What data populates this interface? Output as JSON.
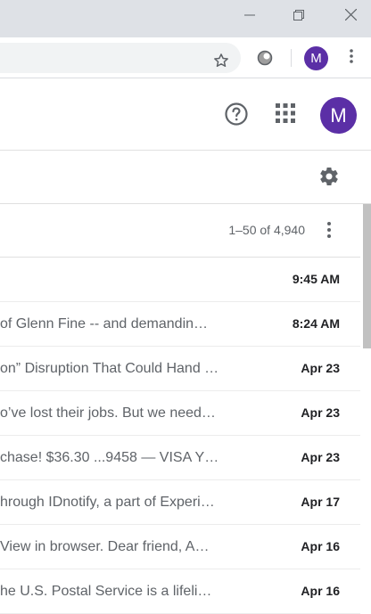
{
  "browser": {
    "window_controls": {
      "minimize_icon": "minimize-icon",
      "restore_icon": "restore-icon",
      "close_icon": "close-icon"
    },
    "profile_initial": "M"
  },
  "gmail_header": {
    "avatar_initial": "M",
    "accent_color": "#5b2fa6"
  },
  "toolbar": {
    "pagination": "1–50 of 4,940"
  },
  "emails": [
    {
      "snippet": "",
      "time": "9:45 AM"
    },
    {
      "snippet": "of Glenn Fine -- and demandin…",
      "time": "8:24 AM"
    },
    {
      "snippet": "on” Disruption That Could Hand …",
      "time": "Apr 23"
    },
    {
      "snippet": "o’ve lost their jobs. But we need…",
      "time": "Apr 23"
    },
    {
      "snippet": "chase! $36.30 ...9458 — VISA Y…",
      "time": "Apr 23"
    },
    {
      "snippet": "hrough IDnotify, a part of Experi…",
      "time": "Apr 17"
    },
    {
      "snippet": " View in browser. Dear friend, A…",
      "time": "Apr 16"
    },
    {
      "snippet": "he U.S. Postal Service is a lifeli…",
      "time": "Apr 16"
    }
  ]
}
